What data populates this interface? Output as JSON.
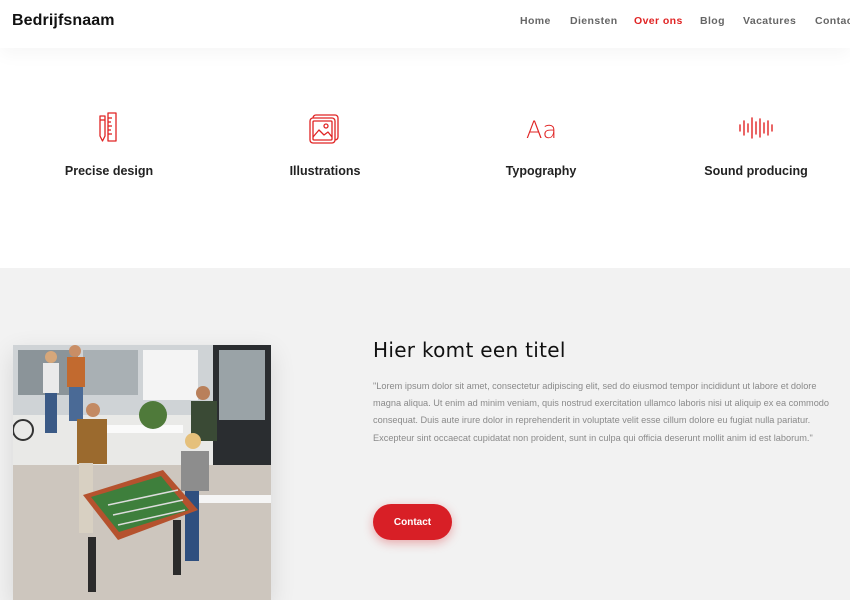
{
  "header": {
    "brand": "Bedrijfsnaam",
    "nav": [
      {
        "label": "Home",
        "active": false
      },
      {
        "label": "Diensten",
        "active": false
      },
      {
        "label": "Over ons",
        "active": true
      },
      {
        "label": "Blog",
        "active": false
      },
      {
        "label": "Vacatures",
        "active": false
      },
      {
        "label": "Contact",
        "active": false
      }
    ]
  },
  "features": [
    {
      "icon": "pencil-ruler-icon",
      "title": "Precise design"
    },
    {
      "icon": "image-icon",
      "title": "Illustrations"
    },
    {
      "icon": "typography-icon",
      "title": "Typography",
      "glyph": "Aa"
    },
    {
      "icon": "soundwave-icon",
      "title": "Sound producing"
    }
  ],
  "about": {
    "title": "Hier komt een titel",
    "body": "\"Lorem ipsum dolor sit amet, consectetur adipiscing elit, sed do eiusmod tempor incididunt ut labore et dolore magna aliqua. Ut enim ad minim veniam, quis nostrud exercitation ullamco laboris nisi ut aliquip ex ea commodo consequat. Duis aute irure dolor in reprehenderit in voluptate velit esse cillum dolore eu fugiat nulla pariatur. Excepteur sint occaecat cupidatat non proident, sunt in culpa qui officia deserunt mollit anim id est laborum.\"",
    "button": "Contact"
  },
  "colors": {
    "accent": "#e02424",
    "button": "#d81f26",
    "section_bg": "#f2f2f2"
  }
}
